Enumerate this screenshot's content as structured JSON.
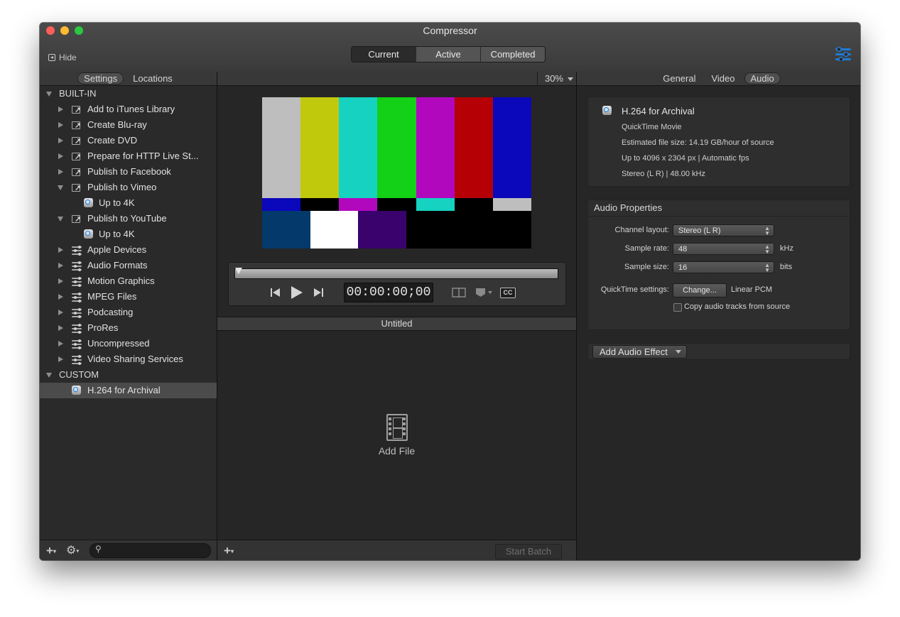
{
  "window": {
    "title": "Compressor",
    "hide_label": "Hide"
  },
  "toolbar": {
    "view_tabs": [
      "Current",
      "Active",
      "Completed"
    ],
    "selected_tab": "Current"
  },
  "settings_pane": {
    "tabs": [
      "Settings",
      "Locations"
    ],
    "selected_tab": "Settings",
    "sections": [
      {
        "label": "BUILT-IN",
        "items": [
          {
            "label": "Add to iTunes Library",
            "icon": "share-icon",
            "expanded": false
          },
          {
            "label": "Create Blu-ray",
            "icon": "share-icon",
            "expanded": false
          },
          {
            "label": "Create DVD",
            "icon": "share-icon",
            "expanded": false
          },
          {
            "label": "Prepare for HTTP Live St...",
            "icon": "share-icon",
            "expanded": false
          },
          {
            "label": "Publish to Facebook",
            "icon": "share-icon",
            "expanded": false
          },
          {
            "label": "Publish to Vimeo",
            "icon": "share-icon",
            "expanded": true,
            "children": [
              "Up to 4K"
            ]
          },
          {
            "label": "Publish to YouTube",
            "icon": "share-icon",
            "expanded": true,
            "children": [
              "Up to 4K"
            ]
          },
          {
            "label": "Apple Devices",
            "icon": "settings-list-icon",
            "expanded": false
          },
          {
            "label": "Audio Formats",
            "icon": "settings-list-icon",
            "expanded": false
          },
          {
            "label": "Motion Graphics",
            "icon": "settings-list-icon",
            "expanded": false
          },
          {
            "label": "MPEG Files",
            "icon": "settings-list-icon",
            "expanded": false
          },
          {
            "label": "Podcasting",
            "icon": "settings-list-icon",
            "expanded": false
          },
          {
            "label": "ProRes",
            "icon": "settings-list-icon",
            "expanded": false
          },
          {
            "label": "Uncompressed",
            "icon": "settings-list-icon",
            "expanded": false
          },
          {
            "label": "Video Sharing Services",
            "icon": "settings-list-icon",
            "expanded": false
          }
        ]
      },
      {
        "label": "CUSTOM",
        "items": [
          {
            "label": "H.264 for Archival",
            "icon": "quicktime-icon",
            "selected": true
          }
        ]
      }
    ],
    "search": {
      "value": "",
      "placeholder": ""
    }
  },
  "preview": {
    "zoom": "30%",
    "timecode": "00:00:00;00",
    "batch_title": "Untitled",
    "add_file_label": "Add File",
    "start_batch_label": "Start Batch",
    "color_bars": {
      "top": [
        "#bebebe",
        "#c1c90d",
        "#15d2c1",
        "#13d116",
        "#b208bd",
        "#b50106",
        "#0b07bb"
      ],
      "middle": [
        "#0b07bb",
        "#000000",
        "#b208bd",
        "#000000",
        "#15d2c1",
        "#000000",
        "#bebebe"
      ],
      "bottom": [
        "#033a6b",
        "#ffffff",
        "#39026c",
        "#000000",
        "#000000",
        "#000000"
      ]
    }
  },
  "inspector": {
    "tabs": [
      "General",
      "Video",
      "Audio"
    ],
    "selected_tab": "Audio",
    "summary": {
      "name": "H.264 for Archival",
      "format": "QuickTime Movie",
      "file_size": "Estimated file size: 14.19 GB/hour of source",
      "video": "Up to 4096 x 2304 px | Automatic fps",
      "audio": "Stereo (L R) | 48.00 kHz"
    },
    "audio_properties": {
      "heading": "Audio Properties",
      "channel_layout_label": "Channel layout:",
      "channel_layout_value": "Stereo (L R)",
      "sample_rate_label": "Sample rate:",
      "sample_rate_value": "48",
      "sample_rate_unit": "kHz",
      "sample_size_label": "Sample size:",
      "sample_size_value": "16",
      "sample_size_unit": "bits",
      "quicktime_label": "QuickTime settings:",
      "change_button": "Change...",
      "codec": "Linear PCM",
      "copy_tracks_label": "Copy audio tracks from source",
      "copy_tracks_checked": false
    },
    "add_effect_label": "Add Audio Effect"
  },
  "colors": {
    "accent": "#1e7ad6",
    "window_bg": "#262626",
    "selection": "#4b4b4b"
  }
}
